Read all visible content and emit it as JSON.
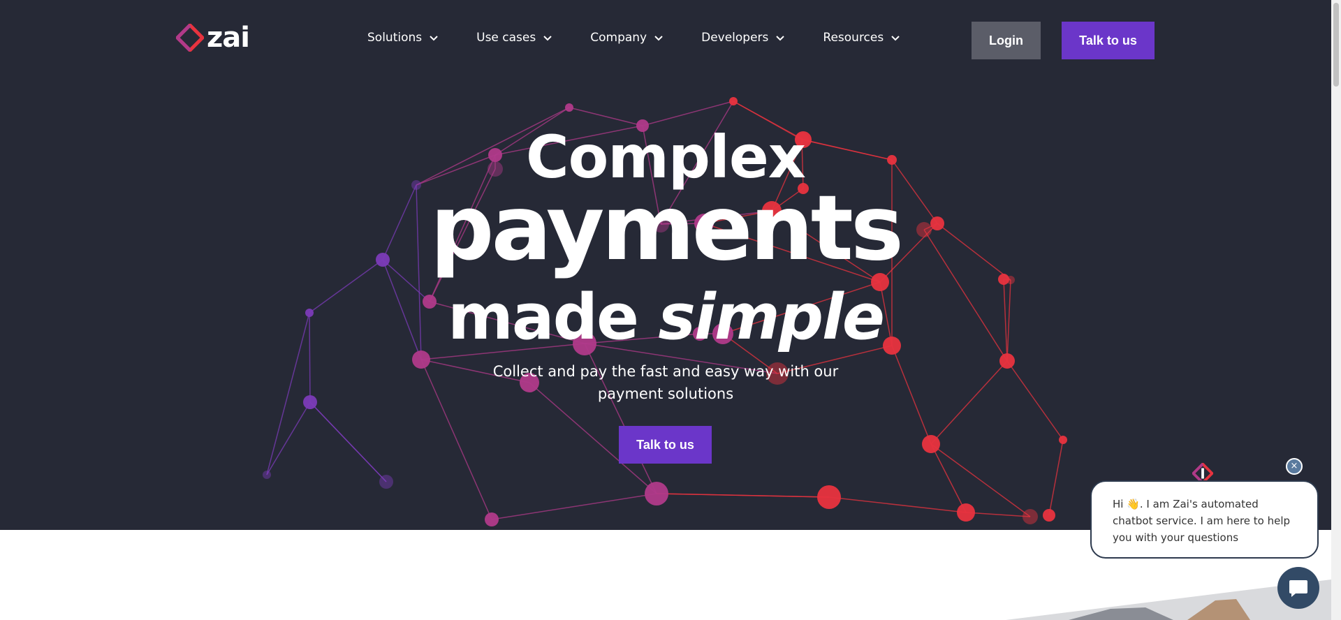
{
  "nav": {
    "logo_text": "zai",
    "menu": [
      {
        "label": "Solutions"
      },
      {
        "label": "Use cases"
      },
      {
        "label": "Company"
      },
      {
        "label": "Developers"
      },
      {
        "label": "Resources"
      }
    ],
    "login_label": "Login",
    "talk_label": "Talk to us"
  },
  "hero": {
    "line1": "Complex",
    "line2": "payments",
    "line3_plain": "made",
    "line3_italic": "simple",
    "subtitle": "Collect and pay the fast and easy way with our payment solutions",
    "cta_label": "Talk to us"
  },
  "chat": {
    "message": "Hi 👋. I am Zai's automated chatbot service. I am here to help you with your questions",
    "close_symbol": "×"
  },
  "colors": {
    "hero_bg": "#262936",
    "brand_purple": "#6b36c9",
    "login_gray": "#5b5d68",
    "sphere_red": "#e8333f",
    "sphere_magenta": "#b03a8a",
    "sphere_violet": "#7b3bb8",
    "chat_navy": "#324a66"
  },
  "icons": {
    "logo": "zai-logo-icon",
    "menu_chevron": "chevron-down-icon",
    "chat_launcher": "chat-bubble-icon",
    "chat_close": "close-icon"
  }
}
